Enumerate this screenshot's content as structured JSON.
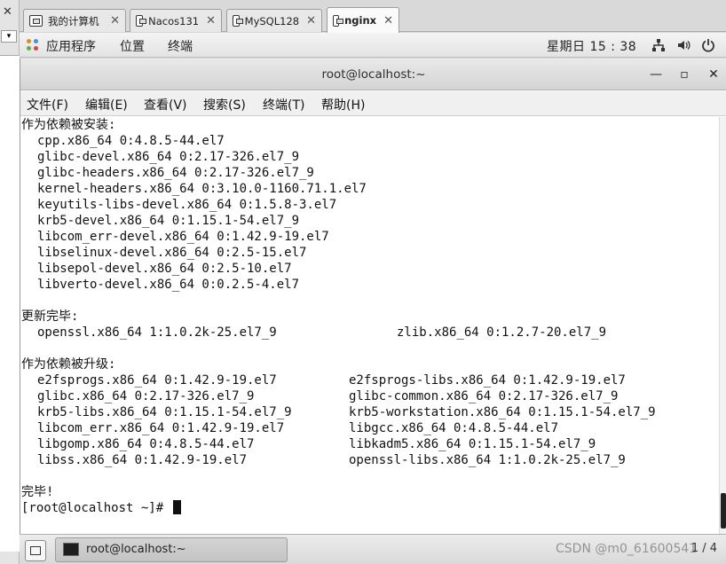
{
  "host_tabs": [
    {
      "label": "我的计算机"
    },
    {
      "label": "Nacos131"
    },
    {
      "label": "MySQL128"
    },
    {
      "label": "nginx"
    }
  ],
  "gnome": {
    "apps": "应用程序",
    "places": "位置",
    "terminal": "终端",
    "clock": "星期日 15 : 38"
  },
  "window": {
    "title": "root@localhost:~",
    "min": "—",
    "max": "▫",
    "close": "✕"
  },
  "menus": [
    "文件(F)",
    "编辑(E)",
    "查看(V)",
    "搜索(S)",
    "终端(T)",
    "帮助(H)"
  ],
  "terminal": {
    "dep_installed_header": "作为依赖被安装:",
    "dep_installed": [
      "cpp.x86_64 0:4.8.5-44.el7",
      "glibc-devel.x86_64 0:2.17-326.el7_9",
      "glibc-headers.x86_64 0:2.17-326.el7_9",
      "kernel-headers.x86_64 0:3.10.0-1160.71.1.el7",
      "keyutils-libs-devel.x86_64 0:1.5.8-3.el7",
      "krb5-devel.x86_64 0:1.15.1-54.el7_9",
      "libcom_err-devel.x86_64 0:1.42.9-19.el7",
      "libselinux-devel.x86_64 0:2.5-15.el7",
      "libsepol-devel.x86_64 0:2.5-10.el7",
      "libverto-devel.x86_64 0:0.2.5-4.el7"
    ],
    "updated_header": "更新完毕:",
    "updated": [
      "openssl.x86_64 1:1.0.2k-25.el7_9",
      "zlib.x86_64 0:1.2.7-20.el7_9"
    ],
    "dep_upgraded_header": "作为依赖被升级:",
    "dep_upgraded_left": [
      "e2fsprogs.x86_64 0:1.42.9-19.el7",
      "glibc.x86_64 0:2.17-326.el7_9",
      "krb5-libs.x86_64 0:1.15.1-54.el7_9",
      "libcom_err.x86_64 0:1.42.9-19.el7",
      "libgomp.x86_64 0:4.8.5-44.el7",
      "libss.x86_64 0:1.42.9-19.el7"
    ],
    "dep_upgraded_right": [
      "e2fsprogs-libs.x86_64 0:1.42.9-19.el7",
      "glibc-common.x86_64 0:2.17-326.el7_9",
      "krb5-workstation.x86_64 0:1.15.1-54.el7_9",
      "libgcc.x86_64 0:4.8.5-44.el7",
      "libkadm5.x86_64 0:1.15.1-54.el7_9",
      "openssl-libs.x86_64 1:1.0.2k-25.el7_9"
    ],
    "complete": "完毕!",
    "prompt": "[root@localhost ~]# "
  },
  "taskbar": {
    "task_label": "root@localhost:~",
    "pager": "1 / 4",
    "watermark": "CSDN @m0_61600541"
  },
  "colors": {
    "terminal_bg": "#ffffff",
    "terminal_fg": "#111111",
    "panel_bg": "#e6e6e6"
  }
}
